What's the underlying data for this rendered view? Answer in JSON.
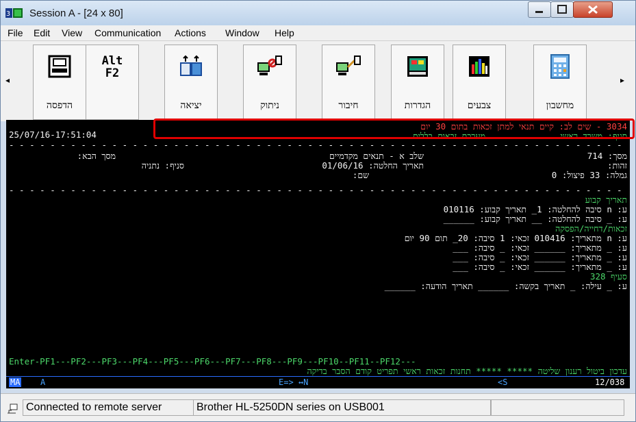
{
  "window": {
    "title": "Session A - [24 x 80]"
  },
  "menu": [
    "File",
    "Edit",
    "View",
    "Communication",
    "Actions",
    "Window",
    "Help"
  ],
  "toolbar": {
    "buttons": [
      {
        "label": "הדפסה",
        "icon": "printer-icon"
      },
      {
        "label": "",
        "icon": "alt-f2-icon",
        "text_top": "Alt",
        "text_bottom": "F2"
      },
      {
        "label": "יציאה",
        "icon": "exit-icon"
      },
      {
        "label": "ניתוק",
        "icon": "disconnect-icon"
      },
      {
        "label": "חיבור",
        "icon": "connect-icon"
      },
      {
        "label": "הגדרות",
        "icon": "settings-icon"
      },
      {
        "label": "צבעים",
        "icon": "colors-icon"
      },
      {
        "label": "מחשבון",
        "icon": "calculator-icon"
      }
    ]
  },
  "terminal": {
    "message": "3034 - שים לב: קיים תנאי למתן זכאות בתום 30 יום",
    "datetime": "25/07/16-17:51:04",
    "header_line2_right": "סניף: משרד ראשי",
    "header_line2_mid": "מערכת זכאות כללית",
    "row_masach_right": "מסך: 714",
    "row_masach_mid": "שלב א - תנאים מקדמיים",
    "row_masach_left": "מסך הבא:",
    "row_zehut_right": "זהות:",
    "row_zehut_mid": "תאריך החלטה: 01/06/16",
    "row_zehut_left": "סניף: נתניה",
    "row_gimla_right": "גמלה: 33 פיצול: 0",
    "row_gimla_mid": "שם:",
    "sec_fixed": "תאריך קבוע",
    "fixed_1": "ע: n סיבה להחלטה: 1_ תאריך קבוע: 010116",
    "fixed_2": "ע: _ סיבה להחלטה: __ תאריך קבוע: ______",
    "sec_rights": "זכאות/דחייה/הפסקה",
    "rights_1": "ע: n מתאריך: 010416 זכאי: 1 סיבה: 20_ תום 90 יום",
    "rights_2": "ע: _ מתאריך: ______ זכאי: _ סיבה: ___",
    "rights_3": "ע: _ מתאריך: ______ זכאי: _ סיבה: ___",
    "rights_4": "ע: _ מתאריך: ______ זכאי: _ סיבה: ___",
    "sec_328": "סעיף 328",
    "row_328": "ע: _ עילה: _ תאריך בקשה: ______ תאריך הודעה: ______",
    "pf_keys": "Enter-PF1---PF2---PF3---PF4---PF5---PF6---PF7---PF8---PF9---PF10--PF11--PF12---",
    "pf_labels": "עדכון ביטול רענון שליטה ***** ***** תחנות זכאות ראשי תפריט קודם הסבר בדיקה"
  },
  "oia": {
    "left": "MA",
    "mode": "A",
    "mid": "E=> ↔N",
    "right_mid": "<S",
    "cursor": "12/038"
  },
  "status": {
    "connection": "Connected to remote server",
    "printer": "Brother HL-5250DN series on USB001"
  }
}
